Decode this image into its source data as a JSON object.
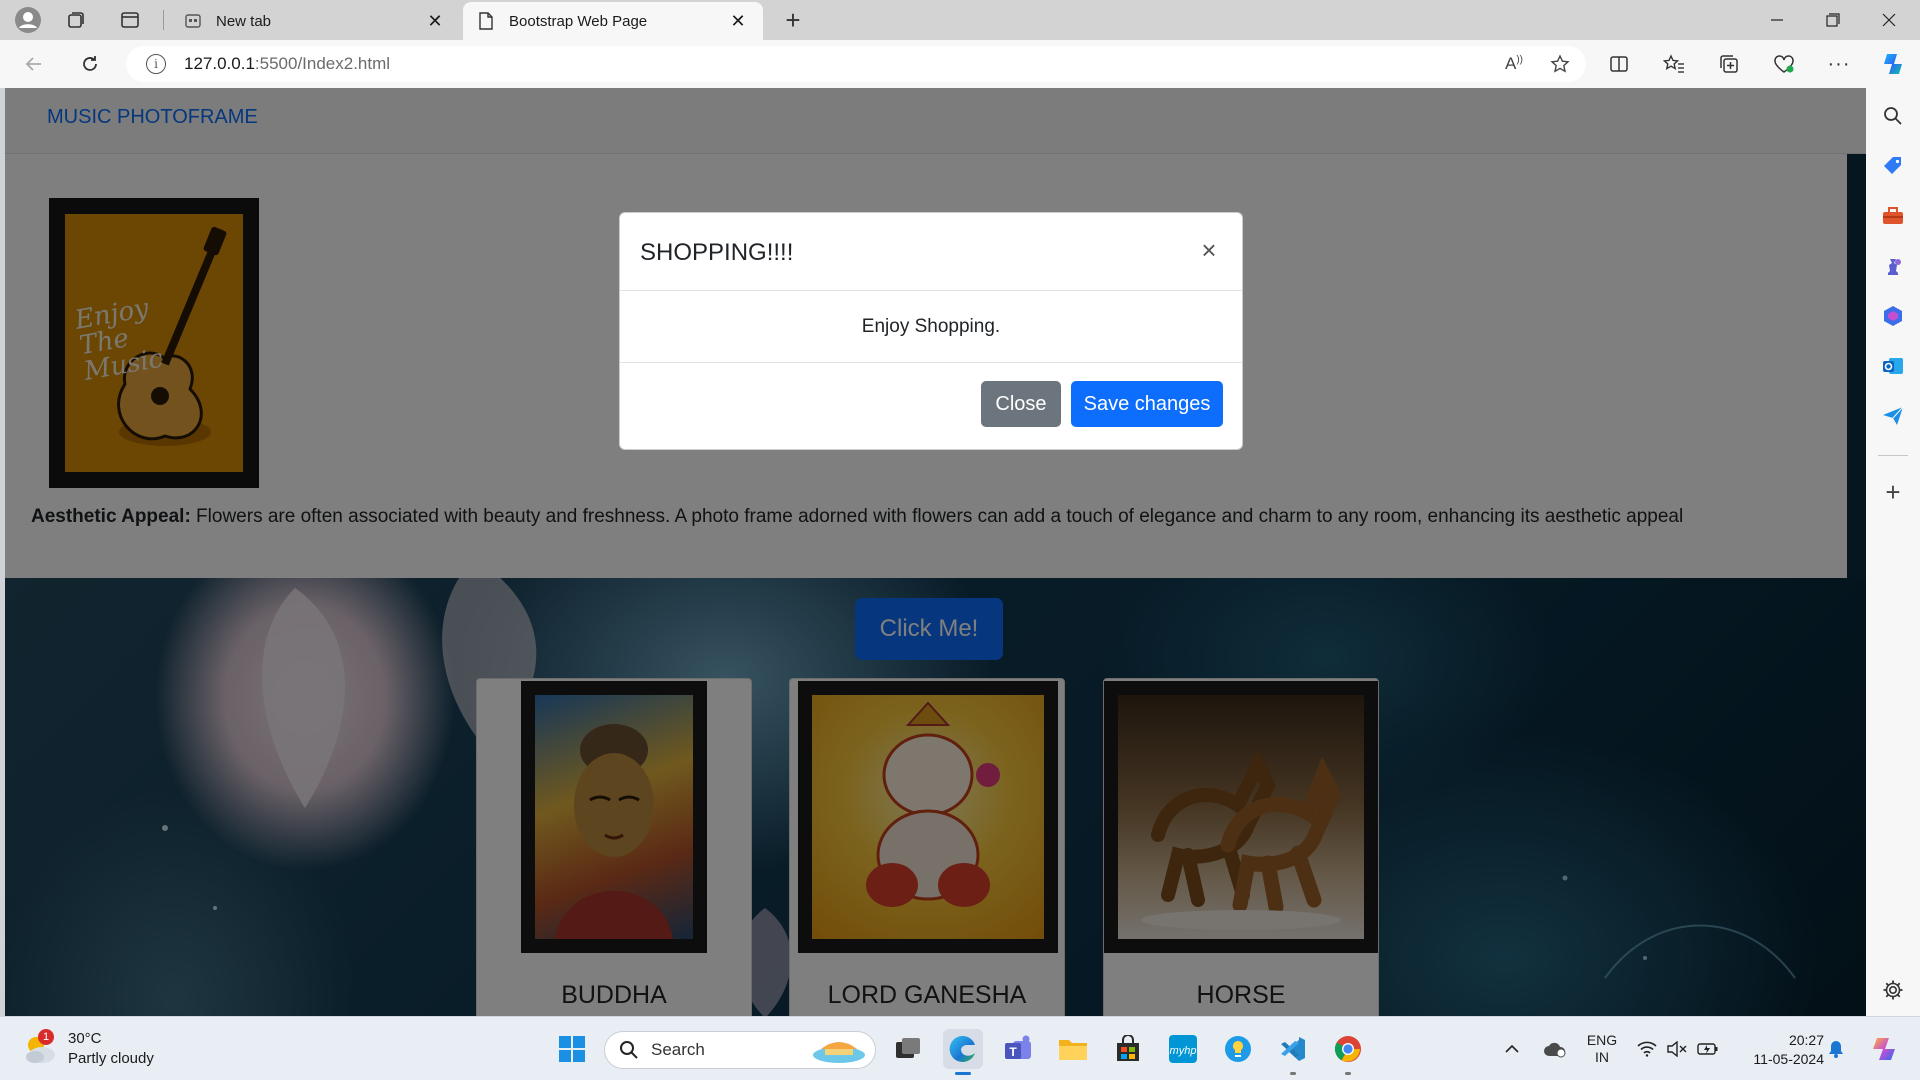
{
  "browser": {
    "tabs": [
      {
        "title": "New tab",
        "active": false
      },
      {
        "title": "Bootstrap Web Page",
        "active": true
      }
    ],
    "url_host": "127.0.0.1",
    "url_rest": ":5500/Index2.html"
  },
  "page": {
    "brand": "MUSIC PHOTOFRAME",
    "feature_label": "Aesthetic Appeal:",
    "feature_text": " Flowers are often associated with beauty and freshness. A photo frame adorned with flowers can add a touch of elegance and charm to any room, enhancing its aesthetic appeal",
    "frame_art_text": "Enjoy The Music",
    "click_button": "Click Me!",
    "cards": [
      {
        "title": "BUDDHA"
      },
      {
        "title": "LORD GANESHA"
      },
      {
        "title": "HORSE"
      }
    ]
  },
  "modal": {
    "title": "SHOPPING!!!!",
    "body": "Enjoy Shopping.",
    "close_label": "Close",
    "save_label": "Save changes",
    "x_label": "×"
  },
  "taskbar": {
    "temperature": "30°C",
    "weather": "Partly cloudy",
    "weather_badge": "1",
    "search_label": "Search",
    "lang_top": "ENG",
    "lang_bottom": "IN",
    "time": "20:27",
    "date": "11-05-2024"
  },
  "colors": {
    "primary": "#0d6efd",
    "secondary": "#6c757d",
    "frame_orange": "#d98f08"
  }
}
